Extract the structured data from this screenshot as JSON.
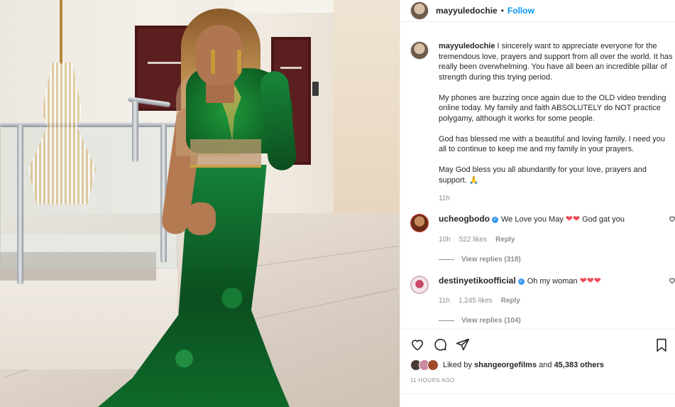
{
  "post": {
    "author": "mayyuledochie",
    "separator": "•",
    "follow_label": "Follow",
    "caption": {
      "username": "mayyuledochie",
      "paragraphs": [
        "I sincerely want to appreciate everyone for the tremendous love, prayers and support from all over the world. It has really been overwhelming. You have all been an incredible pillar of strength during this trying period.",
        "My phones are buzzing once again due to the OLD video trending online today. My family and faith ABSOLUTELY do NOT practice polygamy, although it works for some people.",
        "God has blessed me with a beautiful and loving family. I need you all to continue to keep me and my family in your prayers.",
        "May God bless you all abundantly for your love, prayers and support. 🙏"
      ],
      "time": "11h"
    },
    "comments": [
      {
        "username": "ucheogbodo",
        "verified": true,
        "text_before": "We Love you May",
        "hearts": "❤❤",
        "text_after": "God gat you",
        "time": "10h",
        "likes": "522 likes",
        "reply_label": "Reply",
        "view_replies": "View replies (318)"
      },
      {
        "username": "destinyetikoofficial",
        "verified": true,
        "text_before": "Oh my woman",
        "hearts": "❤❤❤",
        "text_after": "",
        "time": "11h",
        "likes": "1,245 likes",
        "reply_label": "Reply",
        "view_replies": "View replies (104)"
      }
    ],
    "likes": {
      "prefix": "Liked by",
      "user": "shangeorgefilms",
      "connector": "and",
      "others": "45,383 others"
    },
    "timestamp": "11 HOURS AGO"
  },
  "icons": {
    "like": "heart-icon",
    "comment": "comment-icon",
    "share": "share-icon",
    "save": "bookmark-icon",
    "verified": "verified-badge-icon"
  },
  "colors": {
    "link_blue": "#0095f6",
    "verified_blue": "#3897f0",
    "heart_red": "#ed4956",
    "muted_text": "#8e8e8e"
  }
}
